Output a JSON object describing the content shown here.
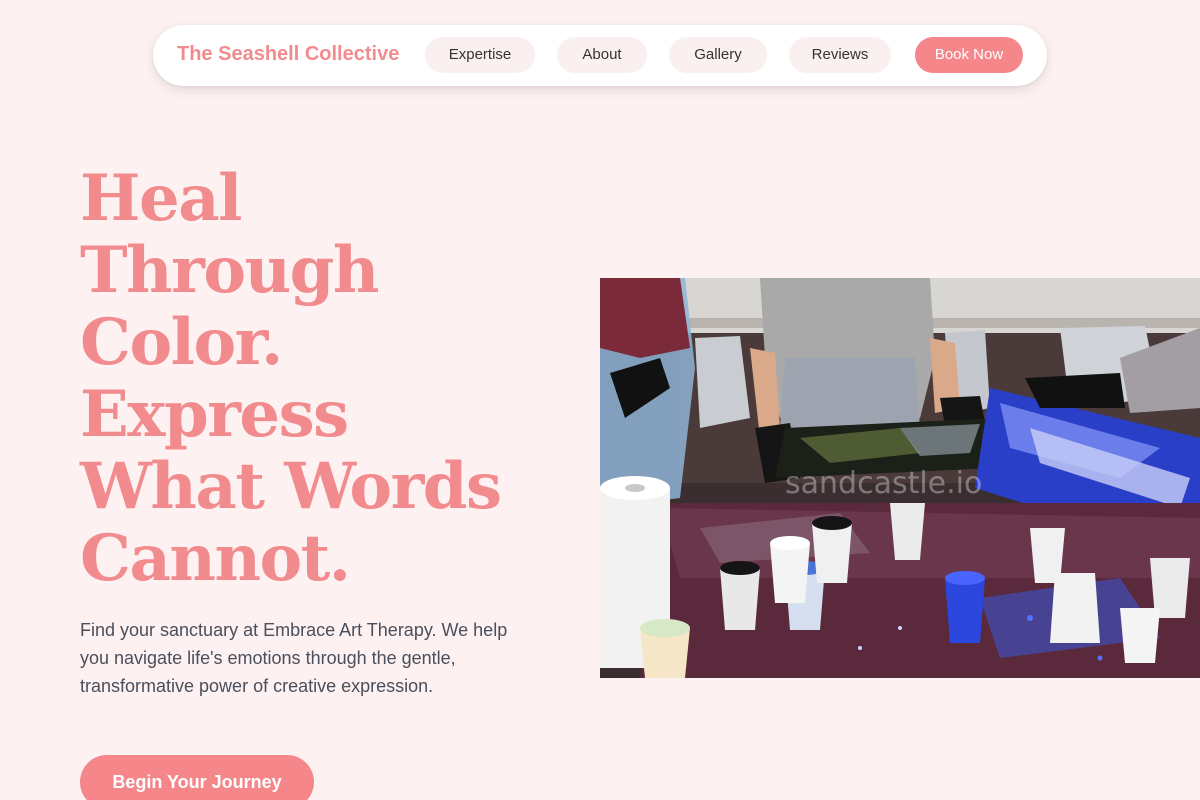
{
  "nav": {
    "brand": "The Seashell Collective",
    "items": [
      {
        "label": "Expertise"
      },
      {
        "label": "About"
      },
      {
        "label": "Gallery"
      },
      {
        "label": "Reviews"
      }
    ],
    "cta_label": "Book Now"
  },
  "hero": {
    "title_lines": [
      "Heal",
      "Through",
      "Color.",
      "Express",
      "What Words",
      "Cannot."
    ],
    "description": "Find your sanctuary at Embrace Art Therapy. We help you navigate life's emotions through the gentle, transformative power of creative expression.",
    "cta_label": "Begin Your Journey",
    "image_watermark": "sandcastle.io"
  },
  "colors": {
    "background": "#fdf1f1",
    "accent": "#f5868a",
    "brand_text": "#f28b8e",
    "body_text": "#4a4f5c"
  }
}
